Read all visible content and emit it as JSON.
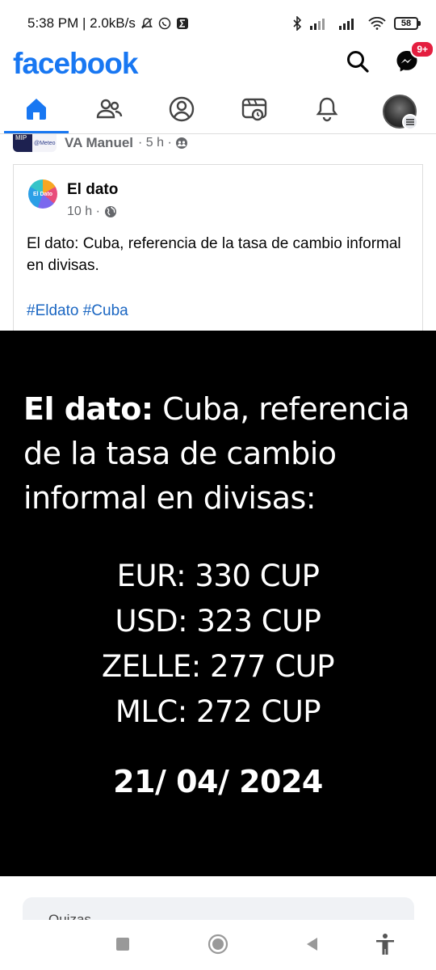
{
  "status_bar": {
    "time_speed": "5:38 PM | 2.0kB/s",
    "battery": "58"
  },
  "header": {
    "logo": "facebook",
    "messenger_badge": "9+",
    "icons": [
      "search-icon",
      "messenger-icon"
    ]
  },
  "nav_tabs": [
    "home",
    "friends",
    "profile",
    "watch",
    "notifications",
    "menu"
  ],
  "shared": {
    "thumb_left": "MIP",
    "thumb_right": "@Meteo",
    "author": "VA Manuel",
    "meta": "· 5 h ·"
  },
  "post": {
    "avatar_text": "El Dato",
    "name": "El dato",
    "time": "10 h ·",
    "text": "El dato: Cuba, referencia de la tasa de cambio informal en divisas.",
    "tags": "#Eldato #Cuba"
  },
  "image": {
    "headline_bold": "El dato:",
    "headline_rest": " Cuba, referencia de la tasa de cambio informal en divisas:",
    "rates": [
      {
        "text": "EUR: 330 CUP"
      },
      {
        "text": "USD: 323 CUP"
      },
      {
        "text": "ZELLE: 277 CUP"
      },
      {
        "text": "MLC: 272 CUP"
      }
    ],
    "date": "21/ 04/ 2024"
  },
  "comment_strip": {
    "text": "Quizas…"
  },
  "colors": {
    "brand": "#1877f2",
    "badge": "#e41e3f",
    "link": "#1a66c2"
  }
}
